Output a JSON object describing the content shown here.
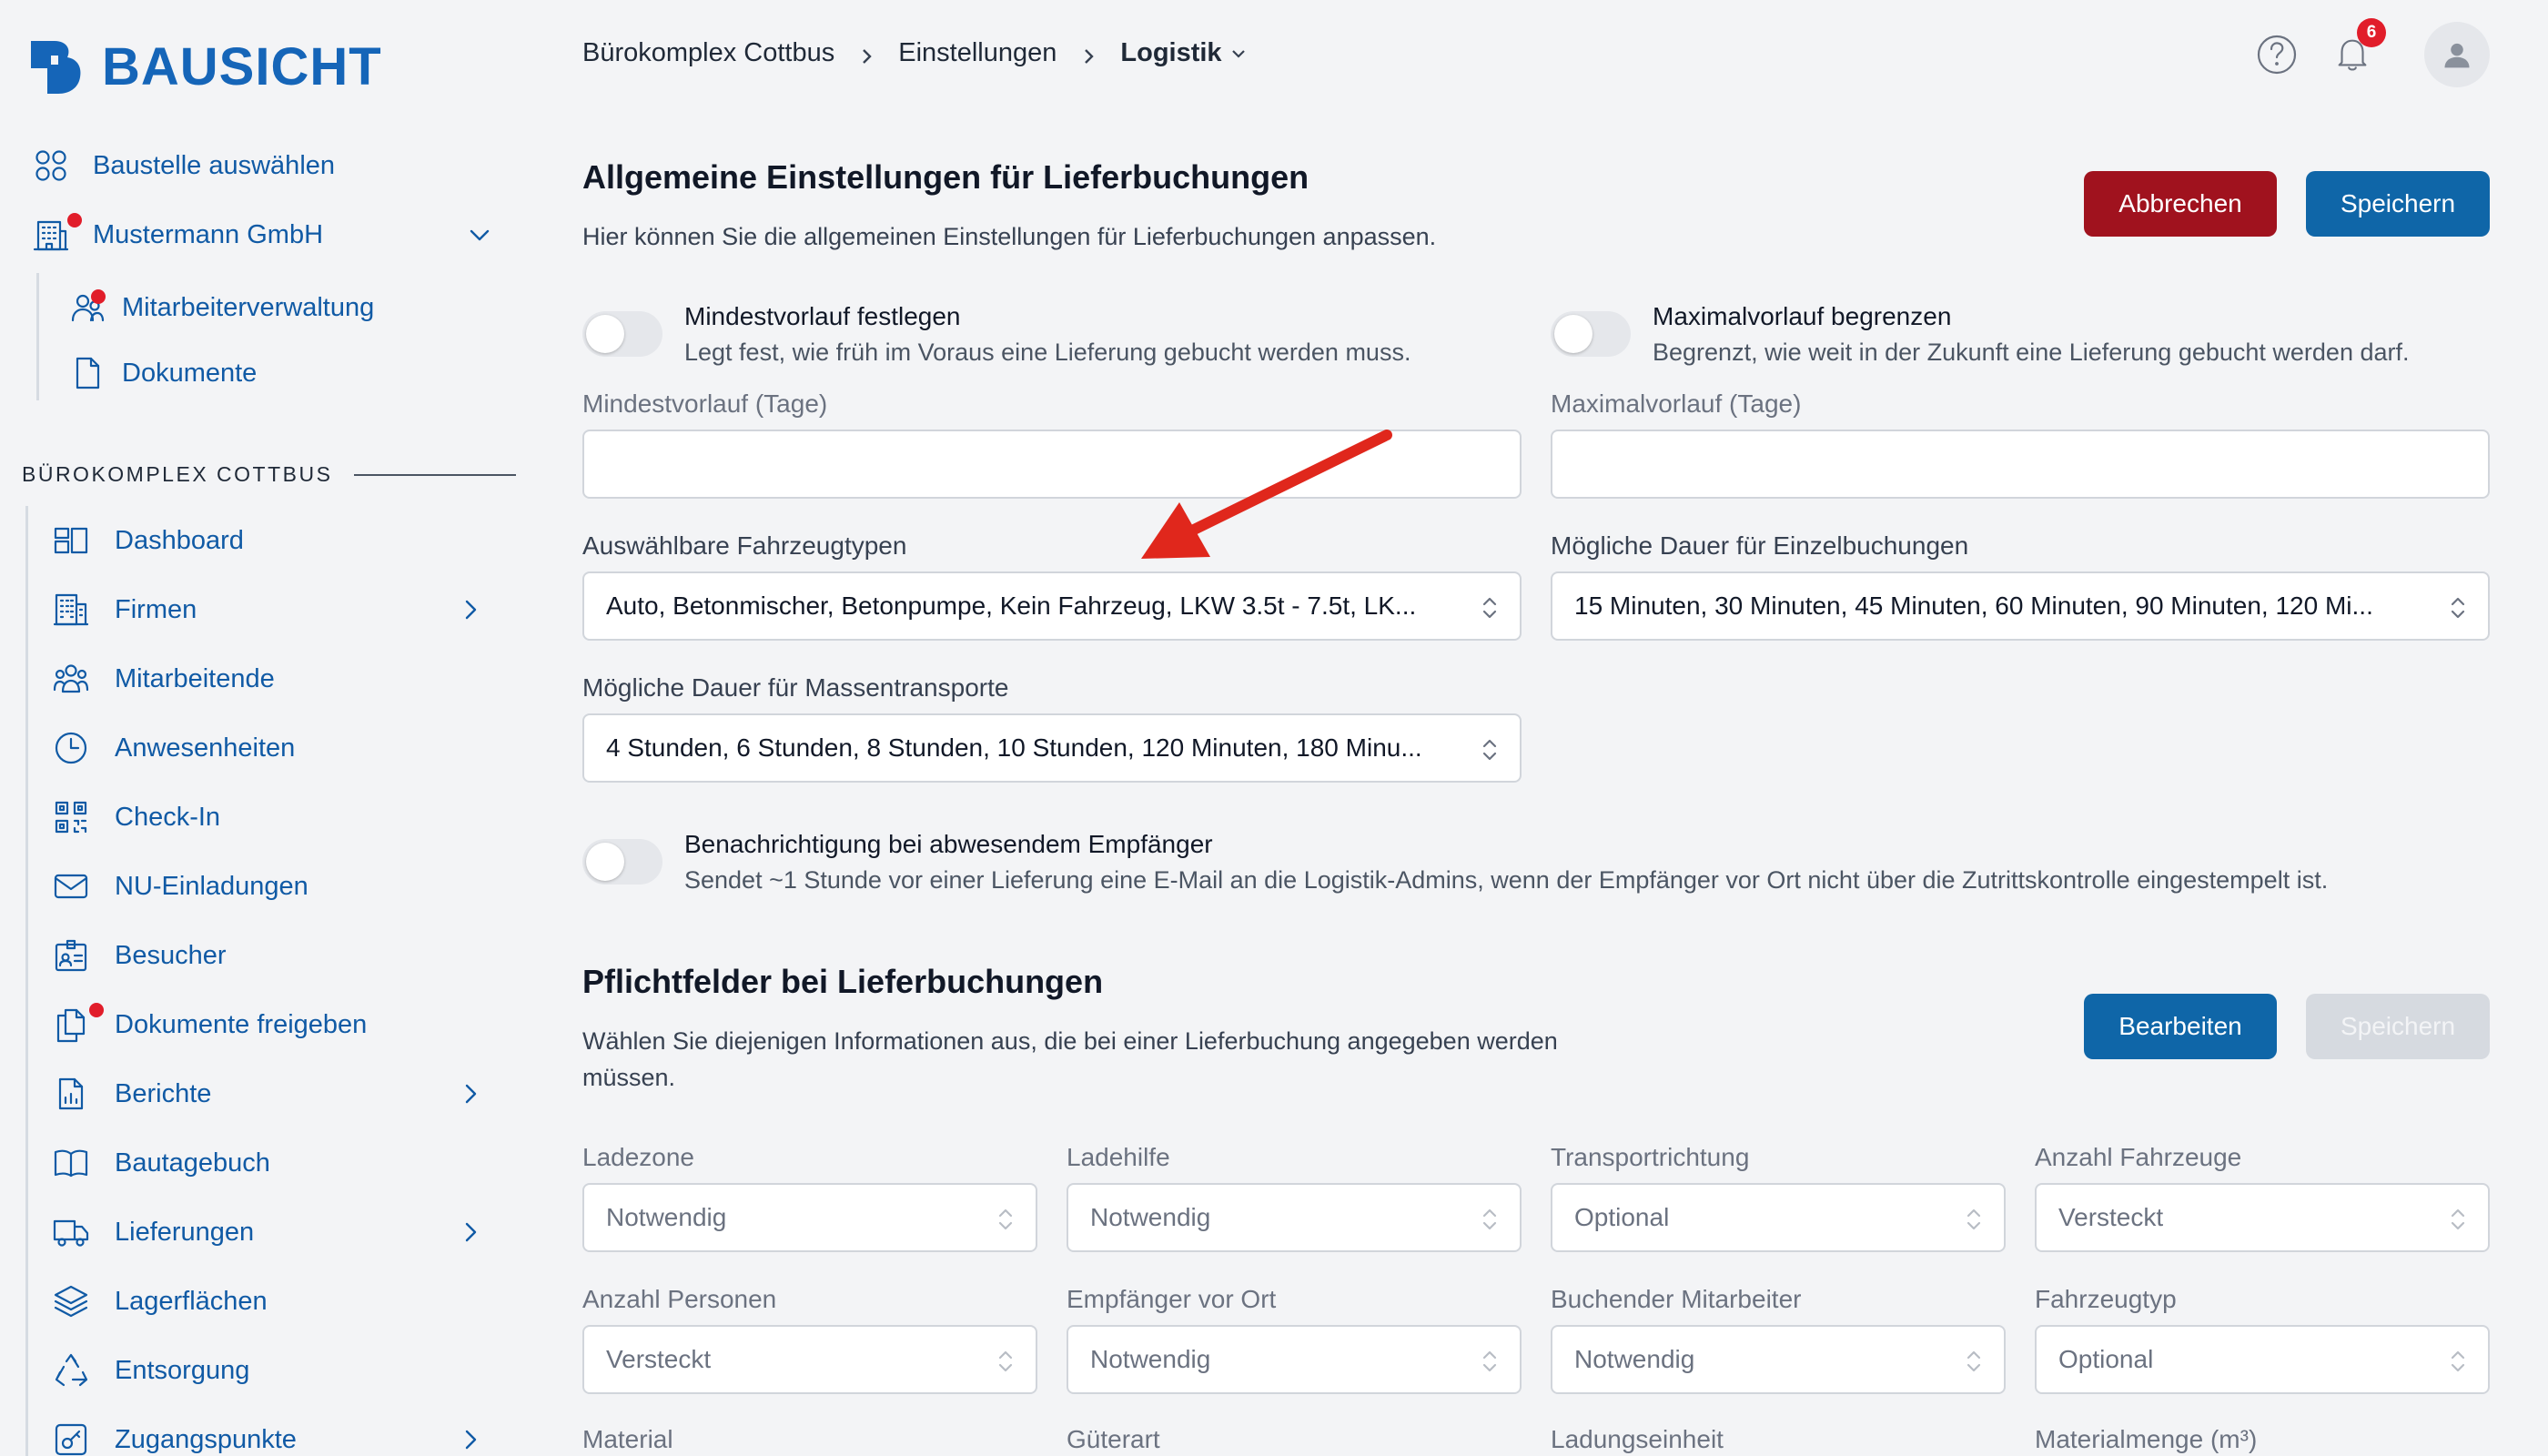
{
  "brand": {
    "name": "BAUSICHT",
    "accent": "#105aa5",
    "danger": "#a0121e",
    "primary": "#0f66a8"
  },
  "sidebar": {
    "top_items": [
      {
        "label": "Baustelle auswählen",
        "icon": "grid-icon"
      },
      {
        "label": "Mustermann GmbH",
        "icon": "building-icon"
      },
      {
        "label": "Mitarbeiterverwaltung",
        "icon": "users-icon"
      },
      {
        "label": "Dokumente",
        "icon": "document-icon"
      }
    ],
    "section_title": "BÜROKOMPLEX COTTBUS",
    "items": [
      {
        "label": "Dashboard",
        "icon": "dashboard-icon"
      },
      {
        "label": "Firmen",
        "icon": "office-icon"
      },
      {
        "label": "Mitarbeitende",
        "icon": "people-icon"
      },
      {
        "label": "Anwesenheiten",
        "icon": "clock-icon"
      },
      {
        "label": "Check-In",
        "icon": "qr-code-icon"
      },
      {
        "label": "NU-Einladungen",
        "icon": "mail-icon"
      },
      {
        "label": "Besucher",
        "icon": "badge-icon"
      },
      {
        "label": "Dokumente freigeben",
        "icon": "documents-icon"
      },
      {
        "label": "Berichte",
        "icon": "report-icon"
      },
      {
        "label": "Bautagebuch",
        "icon": "book-icon"
      },
      {
        "label": "Lieferungen",
        "icon": "truck-icon"
      },
      {
        "label": "Lagerflächen",
        "icon": "layers-icon"
      },
      {
        "label": "Entsorgung",
        "icon": "recycle-icon"
      },
      {
        "label": "Zugangspunkte",
        "icon": "key-icon"
      }
    ]
  },
  "header": {
    "breadcrumb": [
      "Bürokomplex Cottbus",
      "Einstellungen",
      "Logistik"
    ],
    "notifications_count": "6"
  },
  "general": {
    "title": "Allgemeine Einstellungen für Lieferbuchungen",
    "description": "Hier können Sie die allgemeinen Einstellungen für Lieferbuchungen anpassen.",
    "cancel_label": "Abbrechen",
    "save_label": "Speichern",
    "min_lead": {
      "title": "Mindestvorlauf festlegen",
      "desc": "Legt fest, wie früh im Voraus eine Lieferung gebucht werden muss.",
      "field_label": "Mindestvorlauf (Tage)",
      "value": ""
    },
    "max_lead": {
      "title": "Maximalvorlauf begrenzen",
      "desc": "Begrenzt, wie weit in der Zukunft eine Lieferung gebucht werden darf.",
      "field_label": "Maximalvorlauf (Tage)",
      "value": ""
    },
    "vehicle_types": {
      "label": "Auswählbare Fahrzeugtypen",
      "value": "Auto, Betonmischer, Betonpumpe, Kein Fahrzeug, LKW 3.5t - 7.5t, LK..."
    },
    "single_duration": {
      "label": "Mögliche Dauer für Einzelbuchungen",
      "value": "15 Minuten, 30 Minuten, 45 Minuten, 60 Minuten, 90 Minuten, 120 Mi..."
    },
    "mass_duration": {
      "label": "Mögliche Dauer für Massentransporte",
      "value": "4 Stunden, 6 Stunden, 8 Stunden, 10 Stunden, 120 Minuten, 180 Minu..."
    },
    "absent_notify": {
      "title": "Benachrichtigung bei abwesendem Empfänger",
      "desc": "Sendet ~1 Stunde vor einer Lieferung eine E-Mail an die Logistik-Admins, wenn der Empfänger vor Ort nicht über die Zutrittskontrolle eingestempelt ist."
    }
  },
  "required": {
    "title": "Pflichtfelder bei Lieferbuchungen",
    "description_1": "Wählen Sie diejenigen Informationen aus, die bei einer Lieferbuchung angegeben werden",
    "description_2": "müssen.",
    "edit_label": "Bearbeiten",
    "save_label": "Speichern",
    "fields": [
      {
        "label": "Ladezone",
        "value": "Notwendig"
      },
      {
        "label": "Ladehilfe",
        "value": "Notwendig"
      },
      {
        "label": "Transportrichtung",
        "value": "Optional"
      },
      {
        "label": "Anzahl Fahrzeuge",
        "value": "Versteckt"
      },
      {
        "label": "Anzahl Personen",
        "value": "Versteckt"
      },
      {
        "label": "Empfänger vor Ort",
        "value": "Notwendig"
      },
      {
        "label": "Buchender Mitarbeiter",
        "value": "Notwendig"
      },
      {
        "label": "Fahrzeugtyp",
        "value": "Optional"
      },
      {
        "label": "Material",
        "value": ""
      },
      {
        "label": "Güterart",
        "value": ""
      },
      {
        "label": "Ladungseinheit",
        "value": ""
      },
      {
        "label": "Materialmenge (m³)",
        "value": ""
      }
    ]
  }
}
